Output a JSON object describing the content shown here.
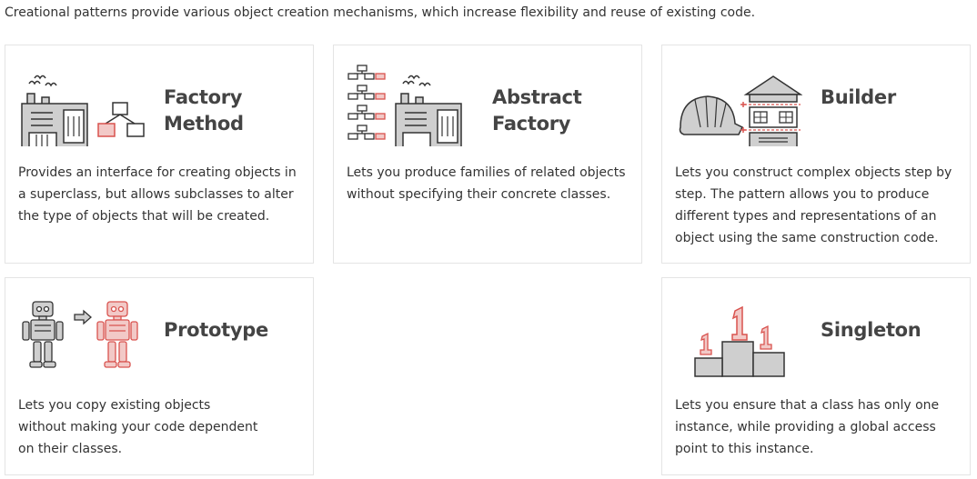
{
  "intro": "Creational patterns provide various object creation mechanisms, which increase flexibility and reuse of existing code.",
  "colors": {
    "accent_red": "#d9534f",
    "outline": "#333333",
    "fill_gray": "#cfcfcf",
    "border": "#e4e4e4"
  },
  "patterns": [
    {
      "title_line1": "Factory",
      "title_line2": "Method",
      "description": "Provides an interface for creating objects in a superclass, but allows subclasses to alter the type of objects that will be created.",
      "icon": "factory-method-icon"
    },
    {
      "title_line1": "Abstract",
      "title_line2": "Factory",
      "description": "Lets you produce families of related objects without specifying their concrete classes.",
      "icon": "abstract-factory-icon"
    },
    {
      "title_line1": "Builder",
      "description": "Lets you construct complex objects step by step. The pattern allows you to produce different types and representations of an object using the same construction code.",
      "icon": "builder-icon"
    },
    {
      "title_line1": "Prototype",
      "description": "Lets you copy existing objects without making your code dependent on their classes.",
      "icon": "prototype-icon"
    },
    {
      "title_line1": "Singleton",
      "description": "Lets you ensure that a class has only one instance, while providing a global access point to this instance.",
      "icon": "singleton-icon"
    }
  ]
}
